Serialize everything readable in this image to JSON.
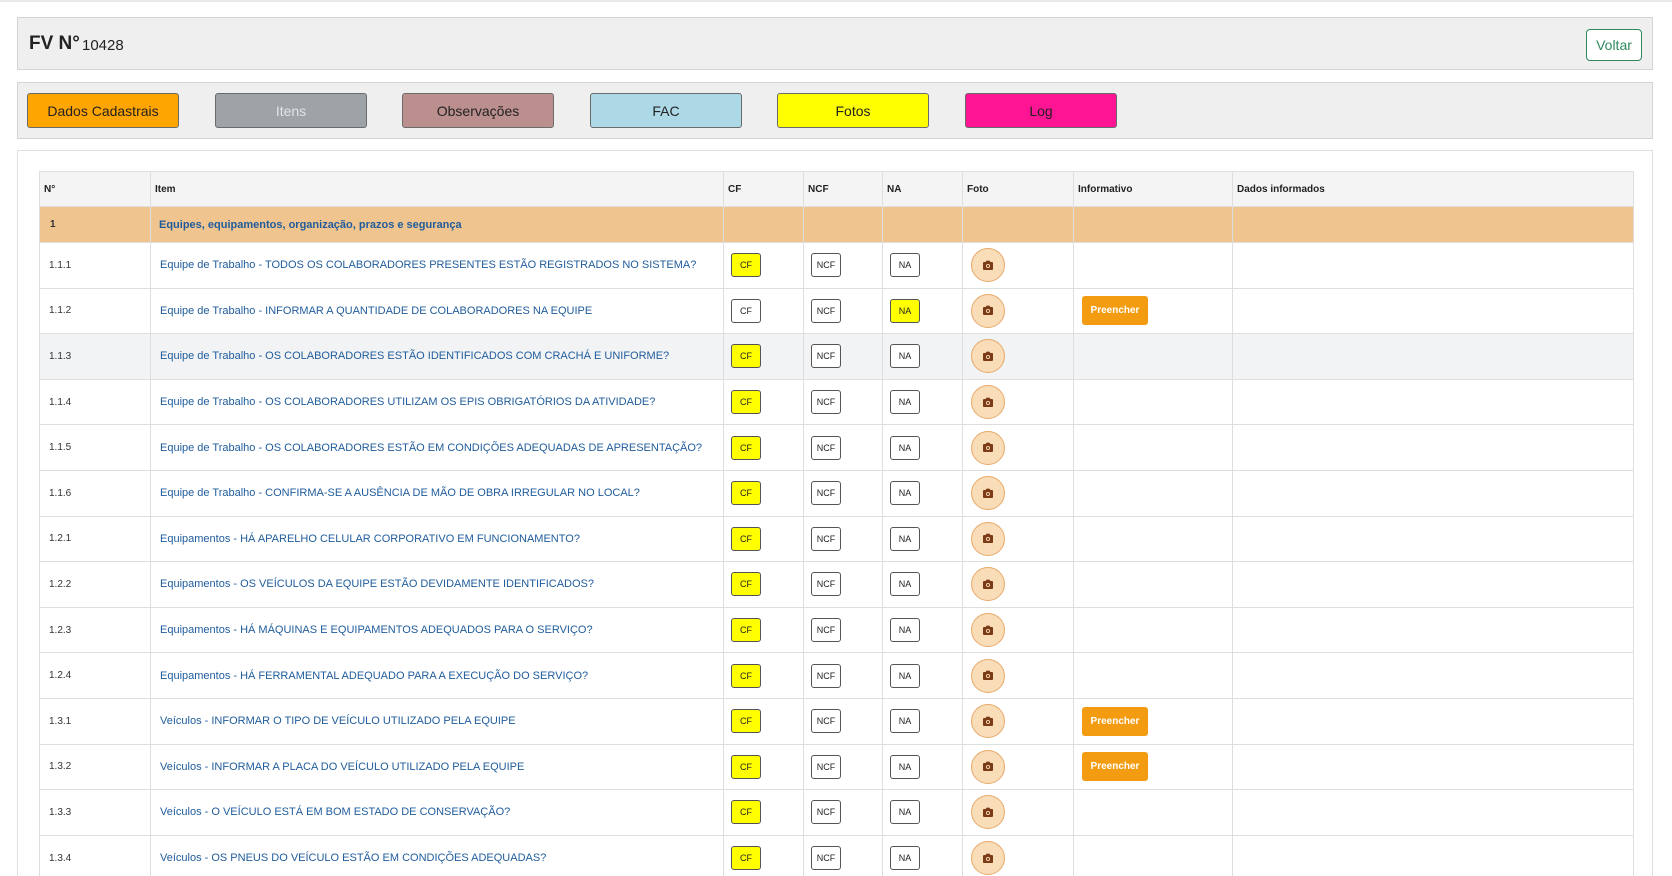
{
  "header": {
    "title": "FV N°",
    "number": "10428",
    "back_label": "Voltar"
  },
  "tabs": [
    {
      "label": "Dados Cadastrais",
      "bg": "#ffa500",
      "color": "#222222"
    },
    {
      "label": "Itens",
      "bg": "#9ea3a8",
      "color": "#e3e3e3"
    },
    {
      "label": "Observações",
      "bg": "#bc8f8f",
      "color": "#222222"
    },
    {
      "label": "FAC",
      "bg": "#add8e6",
      "color": "#222222"
    },
    {
      "label": "Fotos",
      "bg": "#ffff00",
      "color": "#222222"
    },
    {
      "label": "Log",
      "bg": "#ff1493",
      "color": "#222222"
    }
  ],
  "columns": [
    "N°",
    "Item",
    "CF",
    "NCF",
    "NA",
    "Foto",
    "Informativo",
    "Dados informados"
  ],
  "section": {
    "number": "1",
    "title": "Equipes, equipamentos, organização, prazos e segurança"
  },
  "option_labels": {
    "cf": "CF",
    "ncf": "NCF",
    "na": "NA"
  },
  "fill_label": "Preencher",
  "rows": [
    {
      "num": "1.1.1",
      "item": "Equipe de Trabalho - TODOS OS COLABORADORES PRESENTES ESTÃO REGISTRADOS NO SISTEMA?",
      "selected": "cf",
      "info": false
    },
    {
      "num": "1.1.2",
      "item": "Equipe de Trabalho - INFORMAR A QUANTIDADE DE COLABORADORES NA EQUIPE",
      "selected": "na",
      "info": true
    },
    {
      "num": "1.1.3",
      "item": "Equipe de Trabalho - OS COLABORADORES ESTÃO IDENTIFICADOS COM CRACHÁ E UNIFORME?",
      "selected": "cf",
      "info": false,
      "highlight": true
    },
    {
      "num": "1.1.4",
      "item": "Equipe de Trabalho - OS COLABORADORES UTILIZAM OS EPIS OBRIGATÓRIOS DA ATIVIDADE?",
      "selected": "cf",
      "info": false
    },
    {
      "num": "1.1.5",
      "item": "Equipe de Trabalho - OS COLABORADORES ESTÃO EM CONDIÇÕES ADEQUADAS DE APRESENTAÇÃO?",
      "selected": "cf",
      "info": false
    },
    {
      "num": "1.1.6",
      "item": "Equipe de Trabalho - CONFIRMA-SE A AUSÊNCIA DE MÃO DE OBRA IRREGULAR NO LOCAL?",
      "selected": "cf",
      "info": false
    },
    {
      "num": "1.2.1",
      "item": "Equipamentos - HÁ APARELHO CELULAR CORPORATIVO EM FUNCIONAMENTO?",
      "selected": "cf",
      "info": false
    },
    {
      "num": "1.2.2",
      "item": "Equipamentos - OS VEÍCULOS DA EQUIPE ESTÃO DEVIDAMENTE IDENTIFICADOS?",
      "selected": "cf",
      "info": false
    },
    {
      "num": "1.2.3",
      "item": "Equipamentos - HÁ MÁQUINAS E EQUIPAMENTOS ADEQUADOS PARA O SERVIÇO?",
      "selected": "cf",
      "info": false
    },
    {
      "num": "1.2.4",
      "item": "Equipamentos - HÁ FERRAMENTAL ADEQUADO PARA A EXECUÇÃO DO SERVIÇO?",
      "selected": "cf",
      "info": false
    },
    {
      "num": "1.3.1",
      "item": "Veículos - INFORMAR O TIPO DE VEÍCULO UTILIZADO PELA EQUIPE",
      "selected": "cf",
      "info": true
    },
    {
      "num": "1.3.2",
      "item": "Veículos - INFORMAR A PLACA DO VEÍCULO UTILIZADO PELA EQUIPE",
      "selected": "cf",
      "info": true
    },
    {
      "num": "1.3.3",
      "item": "Veículos - O VEÍCULO ESTÁ EM BOM ESTADO DE CONSERVAÇÃO?",
      "selected": "cf",
      "info": false
    },
    {
      "num": "1.3.4",
      "item": "Veículos - OS PNEUS DO VEÍCULO ESTÃO EM CONDIÇÕES ADEQUADAS?",
      "selected": "cf",
      "info": false
    }
  ],
  "colors": {
    "accent": "#2d8a5d",
    "link": "#1f5c9c",
    "section_bg": "#f0c48e",
    "selected": "#ffff00",
    "fill_button": "#f39c12"
  },
  "icons": {
    "photo": "camera-icon"
  }
}
